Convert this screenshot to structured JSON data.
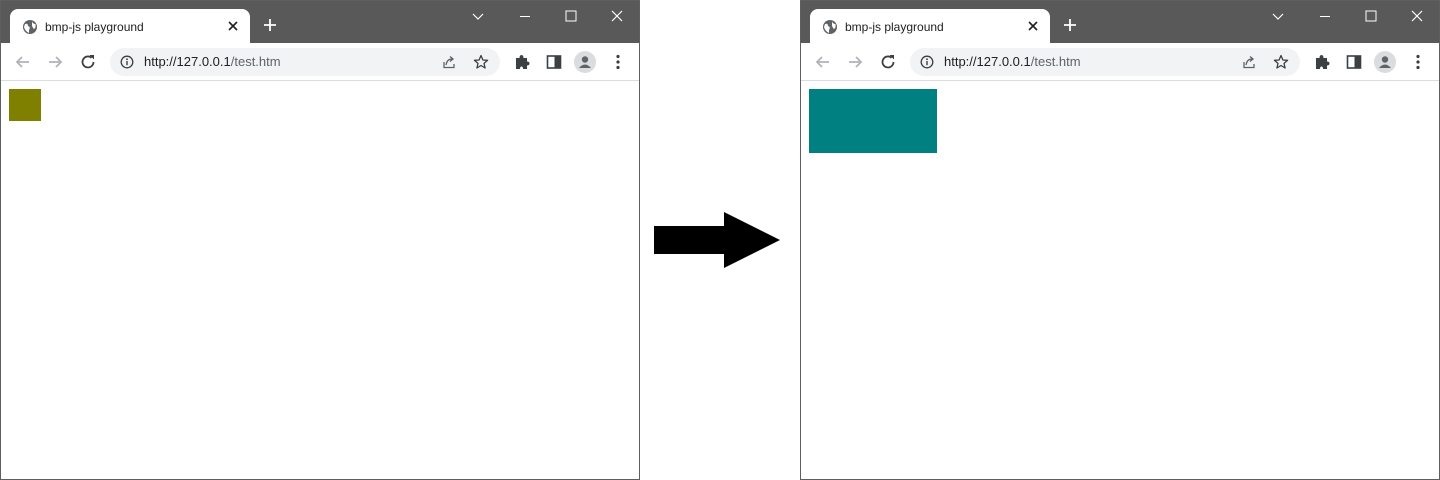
{
  "browsers": [
    {
      "tab_title": "bmp-js playground",
      "url_host": "http://127.0.0.1",
      "url_path": "/test.htm",
      "box_color": "#808000"
    },
    {
      "tab_title": "bmp-js playground",
      "url_host": "http://127.0.0.1",
      "url_path": "/test.htm",
      "box_color": "#008080"
    }
  ],
  "icons": {
    "favicon": "globe-icon",
    "close": "close-icon",
    "new_tab": "plus-icon",
    "tab_search": "chevron-down-icon",
    "minimize": "minimize-icon",
    "maximize": "maximize-icon",
    "window_close": "close-icon",
    "back": "back-arrow-icon",
    "forward": "forward-arrow-icon",
    "reload": "reload-icon",
    "site_info": "info-icon",
    "share": "share-icon",
    "bookmark": "star-icon",
    "extensions": "puzzle-icon",
    "side_panel": "side-panel-icon",
    "profile": "avatar-icon",
    "menu": "kebab-menu-icon",
    "transition": "right-arrow-icon"
  }
}
